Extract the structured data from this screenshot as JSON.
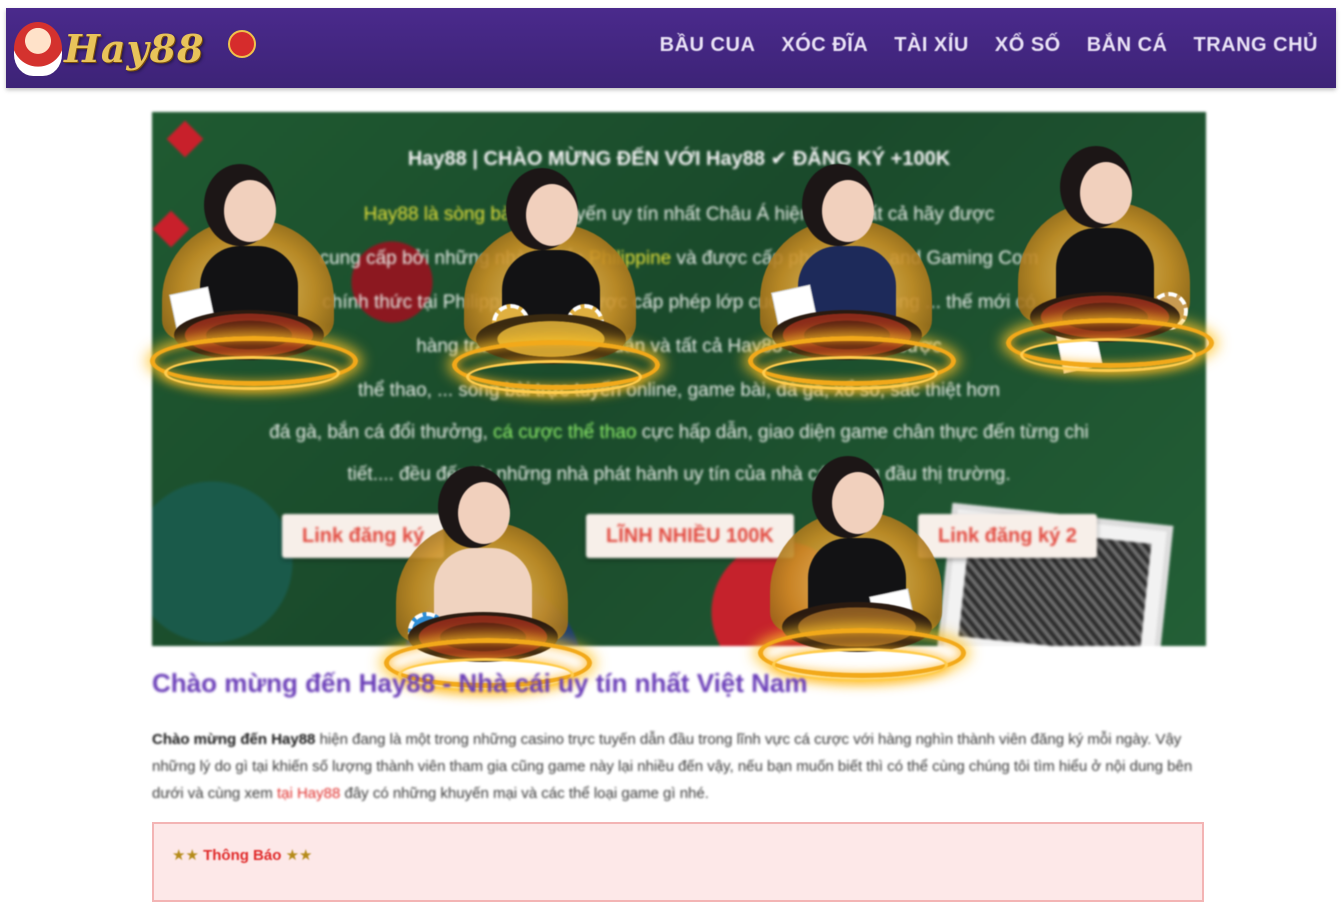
{
  "header": {
    "logo_text": "Hay88",
    "nav": [
      "BẦU CUA",
      "XÓC ĐĨA",
      "TÀI XỈU",
      "XỔ SỐ",
      "BẮN CÁ",
      "TRANG CHỦ"
    ]
  },
  "banner": {
    "title": "Hay88 | CHÀO MỪNG ĐẾN VỚI Hay88 ✔ ĐĂNG KÝ +100K",
    "lines": [
      {
        "pre": "",
        "hl": "Hay88 là sòng bài trực",
        "post": " tuyến uy tín nhất Châu Á hiện nay. Tất cả hãy được"
      },
      {
        "pre": "cung cấp bởi những nhà chuẩn ",
        "hl": "Philippine",
        "post": " và được cấp phép bởi ... and Gaming Com"
      },
      {
        "pre": "",
        "hl": "",
        "post": "chính thức tại Philippine và đã được cấp phép lớp cuối cùng hoạt động ... thế mới có"
      },
      {
        "pre": "",
        "hl": "",
        "post": "hàng trăm trò chơi hấp dẫn và tất cả Hay88 ... sản phẩm cược"
      },
      {
        "pre": "",
        "hl": "",
        "post": "thể thao, ... sòng bài trực tuyến online, game bài, đá gà, xổ số, sắc thiệt hơn"
      },
      {
        "pre": "đá gà, bắn cá đổi thưởng, ",
        "hl": "cá cược thể thao",
        "post": " cực hấp dẫn, giao diện game chân thực đến từng chi"
      },
      {
        "pre": "",
        "hl": "",
        "post": "tiết.... đều đến từ những nhà phát hành uy tín của nhà cái hàng đầu thị trường."
      }
    ],
    "buttons": [
      "Link đăng ký",
      "LĨNH NHIỀU 100K",
      "Link đăng ký 2"
    ]
  },
  "content": {
    "heading": "Chào mừng đến Hay88 - Nhà cái uy tín nhất Việt Nam",
    "intro_bold": "Chào mừng đến Hay88",
    "intro_text": " hiện đang là một trong những casino trực tuyến dẫn đầu trong lĩnh vực cá cược với hàng nghìn thành viên đăng ký mỗi ngày. Vậy những lý do gì tại khiến số lượng thành viên tham gia cũng game này lại nhiều đến vậy, nếu bạn muốn biết thì có thể cùng chúng tôi tìm hiểu ở nội dung bên dưới và cùng xem ",
    "intro_link": "tại Hay88",
    "intro_tail": " đây có những khuyến mại và các thể loại game gì nhé."
  },
  "notice": {
    "title": "Thông Báo",
    "star_icon": "★"
  },
  "colors": {
    "header_bg": "#4a2a8c",
    "accent_purple": "#6b3fb8",
    "link_red": "#e0302e",
    "banner_green": "#1f5a31"
  }
}
